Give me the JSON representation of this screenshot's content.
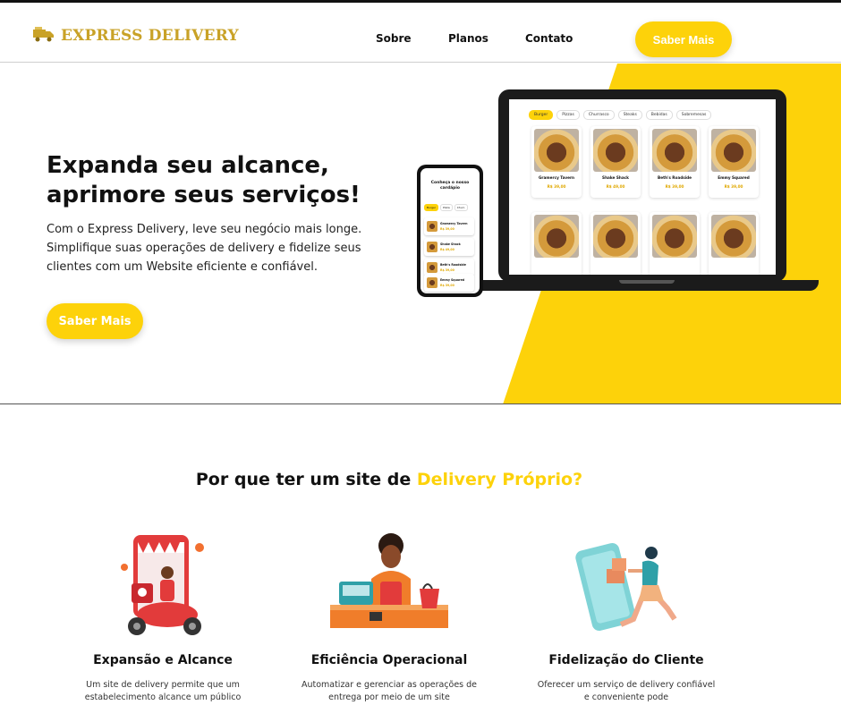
{
  "header": {
    "logo_text": "EXPRESS DELIVERY",
    "nav": [
      "Sobre",
      "Planos",
      "Contato"
    ],
    "cta_label": "Saber Mais"
  },
  "hero": {
    "title": "Expanda seu alcance, aprimore seus serviços!",
    "text": "Com o Express Delivery, leve seu negócio mais longe. Simplifique suas operações de delivery e fidelize seus clientes com um Website eficiente e confiável.",
    "cta_label": "Saber Mais",
    "mockup": {
      "tabs": [
        "Burger",
        "Pizzas",
        "Churrasco",
        "Steaks",
        "Bebidas",
        "Sobremesas"
      ],
      "products": [
        {
          "name": "Gramercy Tavern",
          "price": "R$ 39,00"
        },
        {
          "name": "Shake Shack",
          "price": "R$ 49,00"
        },
        {
          "name": "Beth's Roadside",
          "price": "R$ 39,00"
        },
        {
          "name": "Emmy Squared",
          "price": "R$ 39,00"
        }
      ],
      "phone_title": "Conheça o nosso cardápio",
      "phone_tabs": [
        "Burger",
        "Pizza",
        "Churr."
      ],
      "phone_items": [
        {
          "name": "Gramercy Tavern",
          "price": "R$ 39,00"
        },
        {
          "name": "Shake Shack",
          "price": "R$ 49,00"
        },
        {
          "name": "Beth's Roadside",
          "price": "R$ 39,00"
        },
        {
          "name": "Emmy Squared",
          "price": "R$ 39,00"
        }
      ]
    }
  },
  "why": {
    "title_prefix": "Por que ter um site de ",
    "title_highlight": "Delivery Próprio?",
    "features": [
      {
        "title": "Expansão e Alcance",
        "text": "Um site de delivery permite que um estabelecimento alcance um público"
      },
      {
        "title": "Eficiência Operacional",
        "text": "Automatizar e gerenciar as operações de entrega por meio de um site"
      },
      {
        "title": "Fidelização do Cliente",
        "text": "Oferecer um serviço de delivery confiável e conveniente pode"
      }
    ]
  },
  "colors": {
    "accent": "#fdd20a",
    "logo": "#c9a227"
  }
}
